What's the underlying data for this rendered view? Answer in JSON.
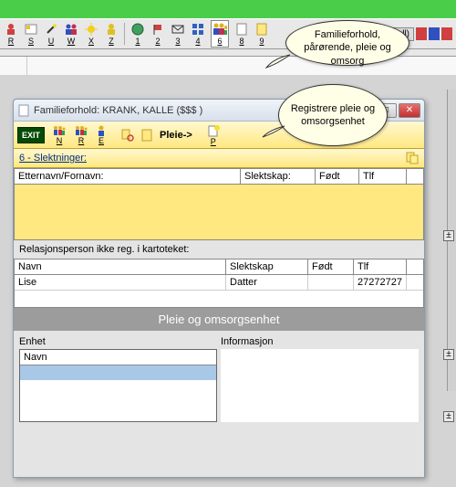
{
  "callout1": "Familieforhold, pårørende, pleie og omsorg",
  "callout2": "Registrere pleie og omsorgsenhet",
  "toolbar": {
    "r": "R",
    "s": "S",
    "u": "U",
    "w": "W",
    "x": "X",
    "z": "Z",
    "n1": "1",
    "n2": "2",
    "n3": "3",
    "n4": "4",
    "n6": "6",
    "n8": "8",
    "n9": "9",
    "null": "(Null)"
  },
  "dialog": {
    "title": "Familieforhold: KRANK, KALLE ($$$ )",
    "tb": {
      "exit": "EXIT",
      "n": "N",
      "r": "R",
      "e": "E",
      "pleie": "Pleie->",
      "p": "P"
    },
    "slekt_header": "6 - Slektninger:",
    "cols1": {
      "a": "Etternavn/Fornavn:",
      "b": "Slektskap:",
      "c": "Født",
      "d": "Tlf"
    },
    "relasjon_label": "Relasjonsperson ikke reg. i kartoteket:",
    "cols2": {
      "a": "Navn",
      "b": "Slektskap",
      "c": "Født",
      "d": "Tlf"
    },
    "row": {
      "navn": "Lise",
      "slekt": "Datter",
      "fodt": "",
      "tlf": "27272727"
    },
    "section_title": "Pleie og omsorgsenhet",
    "enhet_label": "Enhet",
    "info_label": "Informasjon",
    "list_head": "Navn"
  }
}
